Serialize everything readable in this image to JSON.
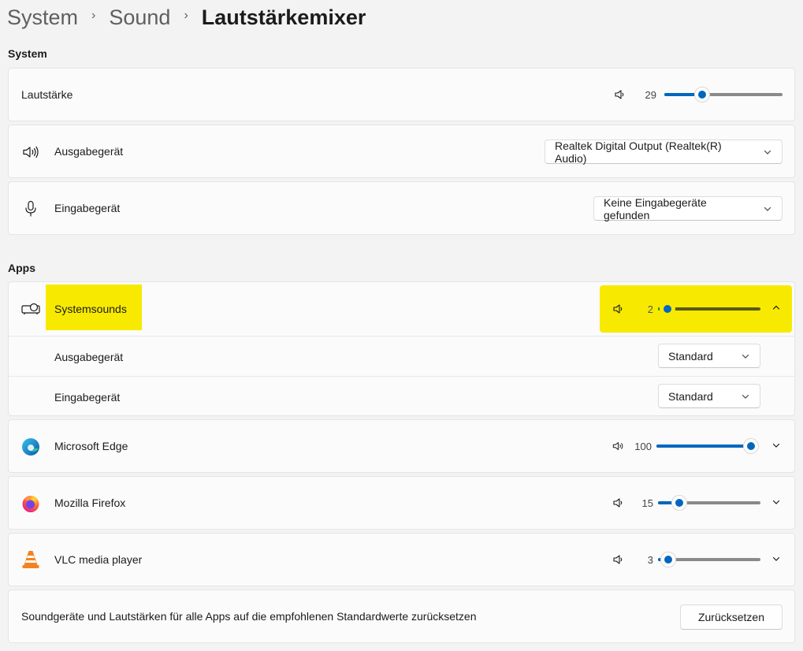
{
  "breadcrumb": [
    "System",
    "Sound",
    "Lautstärkemixer"
  ],
  "system_section": {
    "title": "System",
    "volume": {
      "label": "Lautstärke",
      "value": "29",
      "level_percent": 29,
      "icon": "speaker-low-icon"
    },
    "output": {
      "label": "Ausgabegerät",
      "selected": "Realtek Digital Output (Realtek(R) Audio)",
      "icon": "speaker-high-icon"
    },
    "input": {
      "label": "Eingabegerät",
      "selected": "Keine Eingabegeräte gefunden",
      "icon": "microphone-icon"
    }
  },
  "apps_section": {
    "title": "Apps",
    "apps": [
      {
        "name": "Systemsounds",
        "volume": "2",
        "level_percent": 2,
        "icon": "system-sounds-icon",
        "expanded": true,
        "output_label": "Ausgabegerät",
        "output_selected": "Standard",
        "input_label": "Eingabegerät",
        "input_selected": "Standard"
      },
      {
        "name": "Microsoft Edge",
        "volume": "100",
        "level_percent": 100,
        "icon": "edge-icon",
        "expanded": false
      },
      {
        "name": "Mozilla Firefox",
        "volume": "15",
        "level_percent": 15,
        "icon": "firefox-icon",
        "expanded": false
      },
      {
        "name": "VLC media player",
        "volume": "3",
        "level_percent": 3,
        "icon": "vlc-icon",
        "expanded": false
      }
    ]
  },
  "reset": {
    "text": "Soundgeräte und Lautstärken für alle Apps auf die empfohlenen Standardwerte zurücksetzen",
    "button": "Zurücksetzen"
  },
  "colors": {
    "accent": "#0067c0",
    "highlight": "#f7ea00",
    "background": "#f3f3f3",
    "card": "#fbfbfb"
  }
}
